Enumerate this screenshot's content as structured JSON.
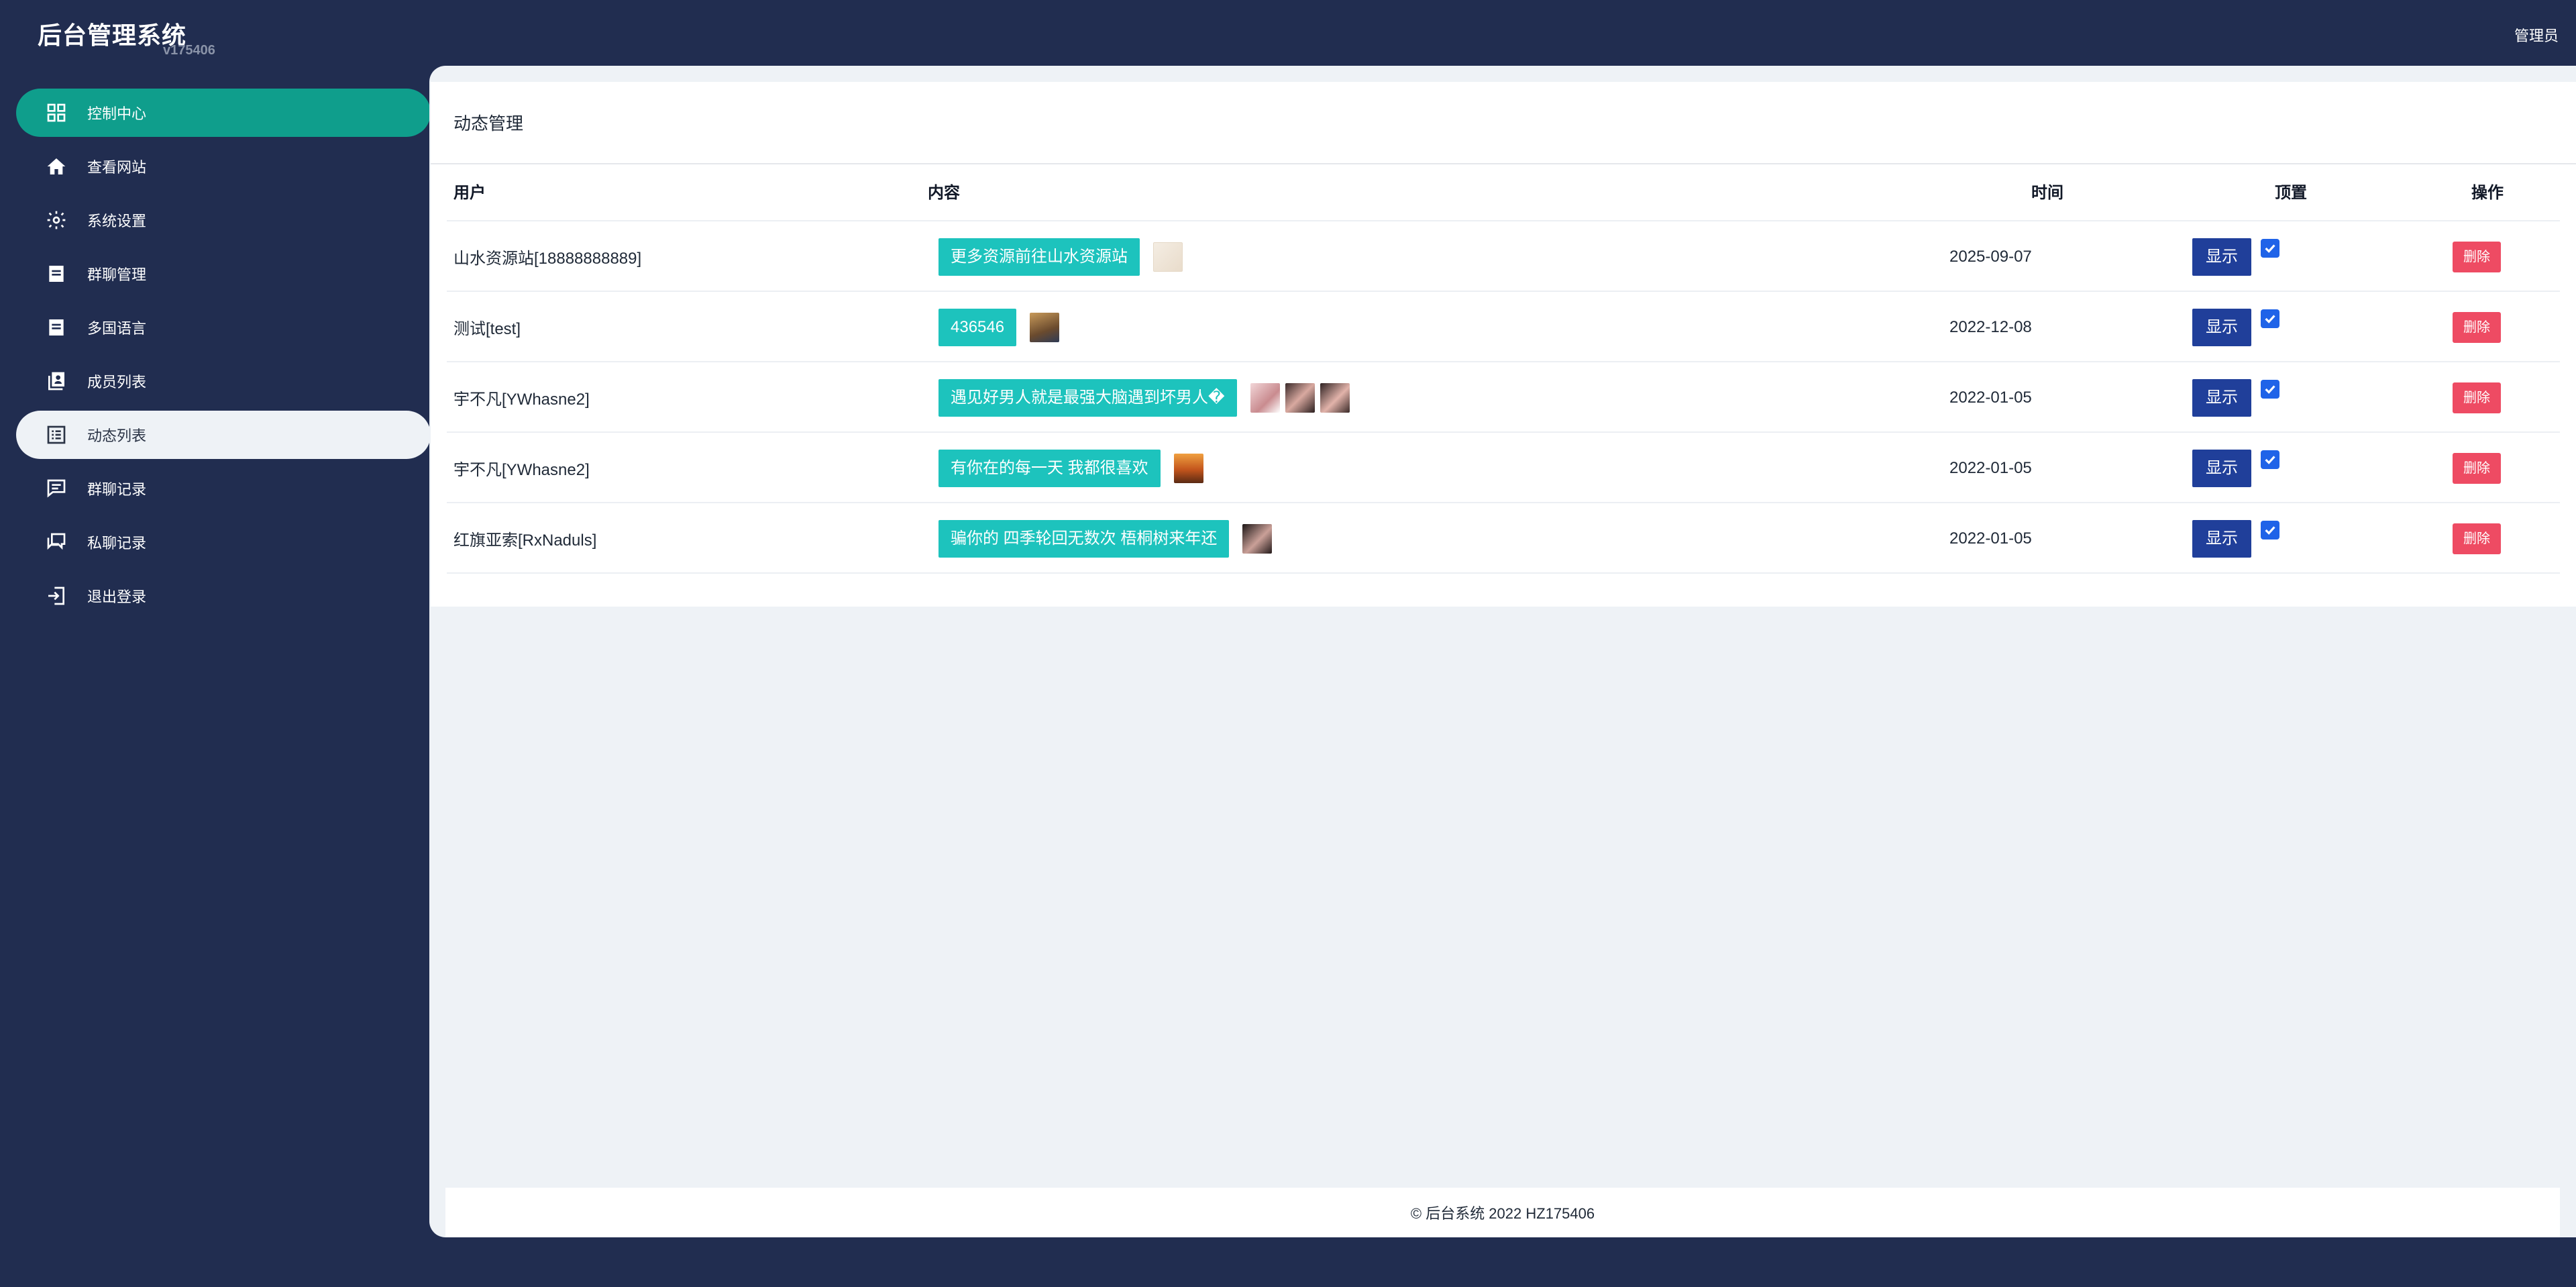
{
  "app": {
    "title": "后台管理系统",
    "version": "v175406",
    "user": "管理员"
  },
  "sidebar": {
    "items": [
      {
        "label": "控制中心",
        "icon": "dashboard-icon"
      },
      {
        "label": "查看网站",
        "icon": "home-icon"
      },
      {
        "label": "系统设置",
        "icon": "gear-icon"
      },
      {
        "label": "群聊管理",
        "icon": "document-icon"
      },
      {
        "label": "多国语言",
        "icon": "document-icon"
      },
      {
        "label": "成员列表",
        "icon": "contacts-icon"
      },
      {
        "label": "动态列表",
        "icon": "list-icon"
      },
      {
        "label": "群聊记录",
        "icon": "chat-icon"
      },
      {
        "label": "私聊记录",
        "icon": "chats-icon"
      },
      {
        "label": "退出登录",
        "icon": "logout-icon"
      }
    ]
  },
  "panel": {
    "title": "动态管理"
  },
  "table": {
    "headers": [
      "用户",
      "内容",
      "时间",
      "顶置",
      "操作"
    ],
    "rows": [
      {
        "user": "山水资源站[18888888889]",
        "content": "更多资源前往山水资源站",
        "time": "2025-09-07",
        "show": "显示",
        "pinned": true,
        "delete": "删除",
        "images": 1
      },
      {
        "user": "测试[test]",
        "content": "436546",
        "time": "2022-12-08",
        "show": "显示",
        "pinned": true,
        "delete": "删除",
        "images": 1
      },
      {
        "user": "宇不凡[YWhasne2]",
        "content": "遇见好男人就是最强大脑遇到坏男人�",
        "time": "2022-01-05",
        "show": "显示",
        "pinned": true,
        "delete": "删除",
        "images": 3
      },
      {
        "user": "宇不凡[YWhasne2]",
        "content": "有你在的每一天 我都很喜欢",
        "time": "2022-01-05",
        "show": "显示",
        "pinned": true,
        "delete": "删除",
        "images": 1
      },
      {
        "user": "红旗亚索[RxNaduls]",
        "content": "骗你的 四季轮回无数次 梧桐树来年还",
        "time": "2022-01-05",
        "show": "显示",
        "pinned": true,
        "delete": "删除",
        "images": 1
      }
    ]
  },
  "footer": {
    "text": "© 后台系统 2022 HZ175406"
  },
  "colors": {
    "sidebar": "#212d50",
    "active": "#0f9e8c",
    "tag": "#1dc3bd",
    "show": "#203f9a",
    "delete": "#ee4b63",
    "checkbox": "#1f63e8"
  }
}
